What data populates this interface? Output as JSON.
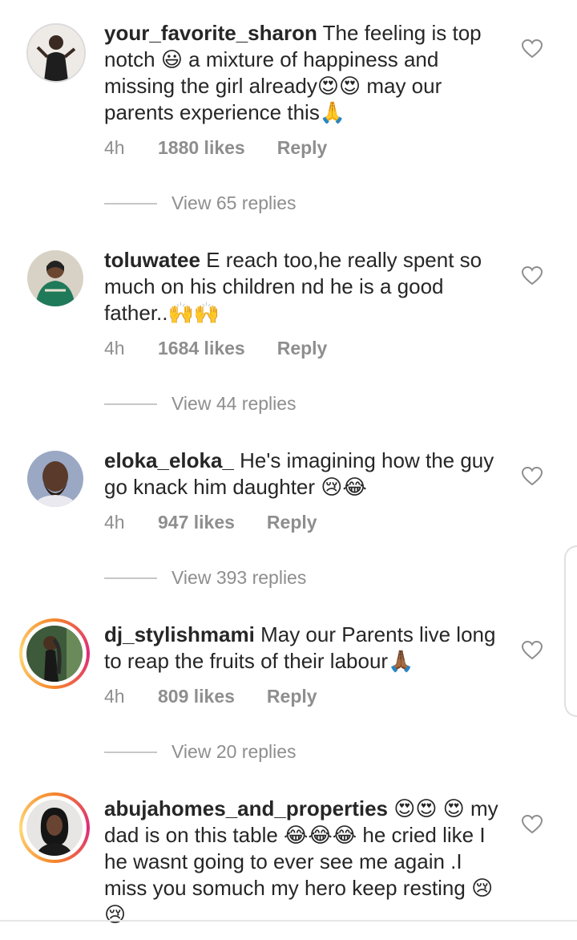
{
  "comments": [
    {
      "username": "your_favorite_sharon",
      "text": " The feeling is top notch 😃 a mixture of happiness and missing the girl already😍😍 may our parents experience this🙏",
      "time": "4h",
      "likes": "1880 likes",
      "reply": "Reply",
      "view_replies": "View 65 replies",
      "avatar_colors": [
        "#e9e4e0",
        "#2b2b2b"
      ]
    },
    {
      "username": "toluwatee",
      "text": " E reach too,he really spent so much on his children nd he is a good father..🙌🙌",
      "time": "4h",
      "likes": "1684 likes",
      "reply": "Reply",
      "view_replies": "View 44 replies",
      "avatar_colors": [
        "#d8d2c6",
        "#1f7a5a"
      ]
    },
    {
      "username": "eloka_eloka_",
      "text": " He's imagining how the guy go knack him daughter 😢😂",
      "time": "4h",
      "likes": "947 likes",
      "reply": "Reply",
      "view_replies": "View 393 replies",
      "avatar_colors": [
        "#9aa8c4",
        "#5a3a2a"
      ]
    },
    {
      "username": "dj_stylishmami",
      "text": " May our Parents live long to reap the fruits of their labour🙏🏾",
      "time": "4h",
      "likes": "809 likes",
      "reply": "Reply",
      "view_replies": "View 20 replies",
      "avatar_colors": [
        "#3d5a3a",
        "#1a1a1a"
      ]
    },
    {
      "username": "abujahomes_and_properties",
      "text": " 😍😍 😍 my dad is on  this table 😂😂😂 he cried like I he wasnt going to ever see me again .I miss you somuch my hero keep resting 😢😢",
      "avatar_colors": [
        "#e8e6e4",
        "#151515"
      ]
    }
  ]
}
